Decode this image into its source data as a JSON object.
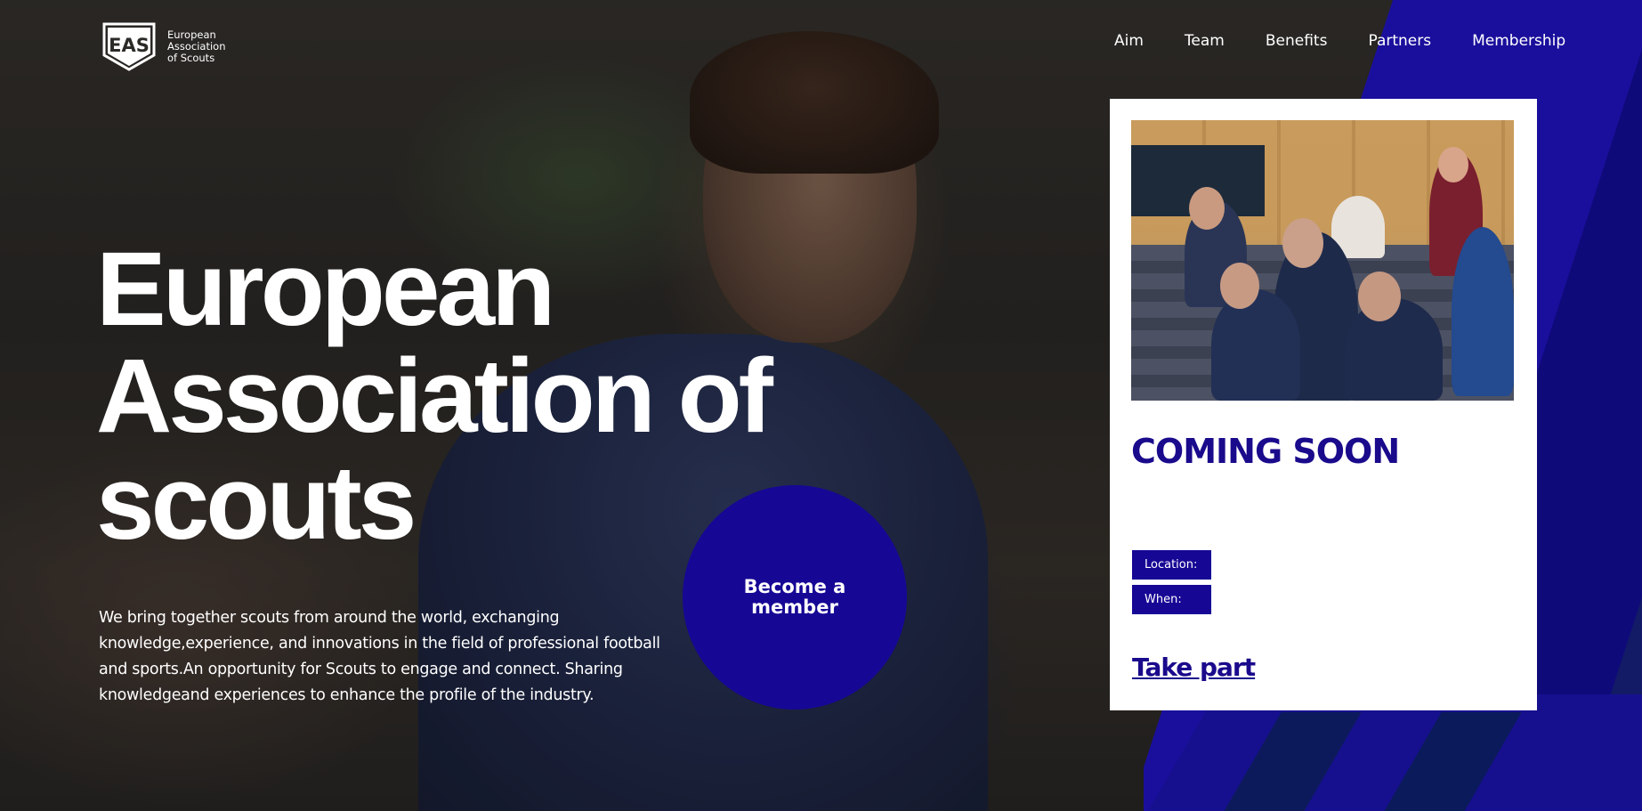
{
  "brand": {
    "logo_letters": "EAS",
    "line1": "European",
    "line2": "Association",
    "line3": "of Scouts"
  },
  "nav": {
    "items": [
      {
        "label": "Aim"
      },
      {
        "label": "Team"
      },
      {
        "label": "Benefits"
      },
      {
        "label": "Partners"
      },
      {
        "label": "Membership"
      }
    ]
  },
  "hero": {
    "title_line1": "European",
    "title_line2": "Association of",
    "title_line3": "scouts",
    "description": "We bring together scouts from around the world, exchanging knowledge,experience, and innovations in the field of professional football and sports.An opportunity for Scouts to engage and connect. Sharing knowledgeand experiences to enhance the profile of the industry.",
    "cta_label": "Become a member"
  },
  "event_card": {
    "title": "COMING SOON",
    "location_label": "Location:",
    "when_label": "When:",
    "action_label": "Take part"
  },
  "colors": {
    "accent": "#170795",
    "accent_text": "#1a0a8c",
    "card_bg": "#ffffff"
  },
  "icons": {
    "logo": "eas-shield-logo"
  }
}
